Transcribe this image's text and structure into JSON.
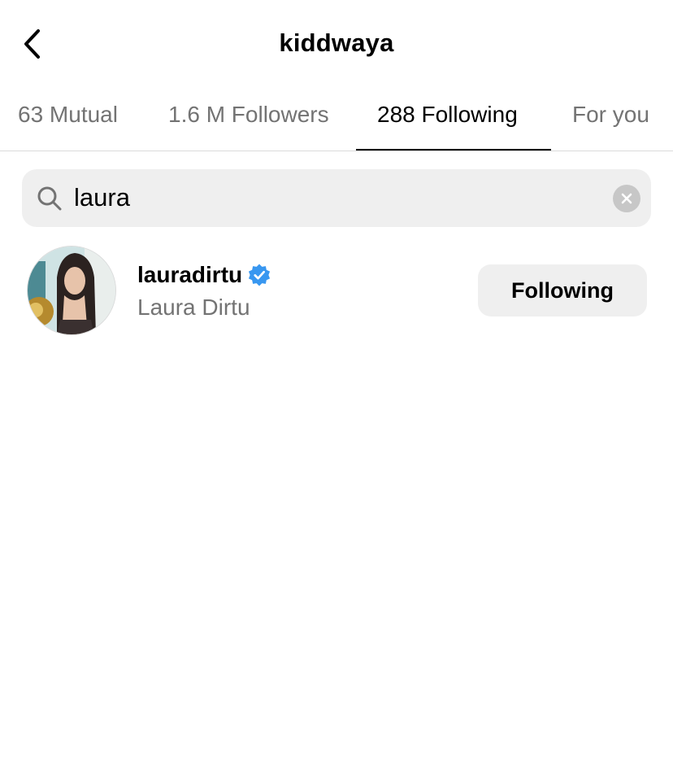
{
  "header": {
    "title": "kiddwaya",
    "back_icon": "chevron-left-icon"
  },
  "tabs": [
    {
      "label": "63 Mutual",
      "active": false
    },
    {
      "label": "1.6 M Followers",
      "active": false
    },
    {
      "label": "288 Following",
      "active": true
    },
    {
      "label": "For you",
      "active": false
    }
  ],
  "search": {
    "value": "laura",
    "placeholder": "Search",
    "icon": "search-icon",
    "clear_icon": "clear-icon"
  },
  "results": [
    {
      "username": "lauradirtu",
      "full_name": "Laura Dirtu",
      "verified": true,
      "button_label": "Following"
    }
  ],
  "colors": {
    "verified_blue": "#3897f0",
    "secondary_text": "#737373",
    "button_bg": "#efefef",
    "search_bg": "#efefef"
  }
}
